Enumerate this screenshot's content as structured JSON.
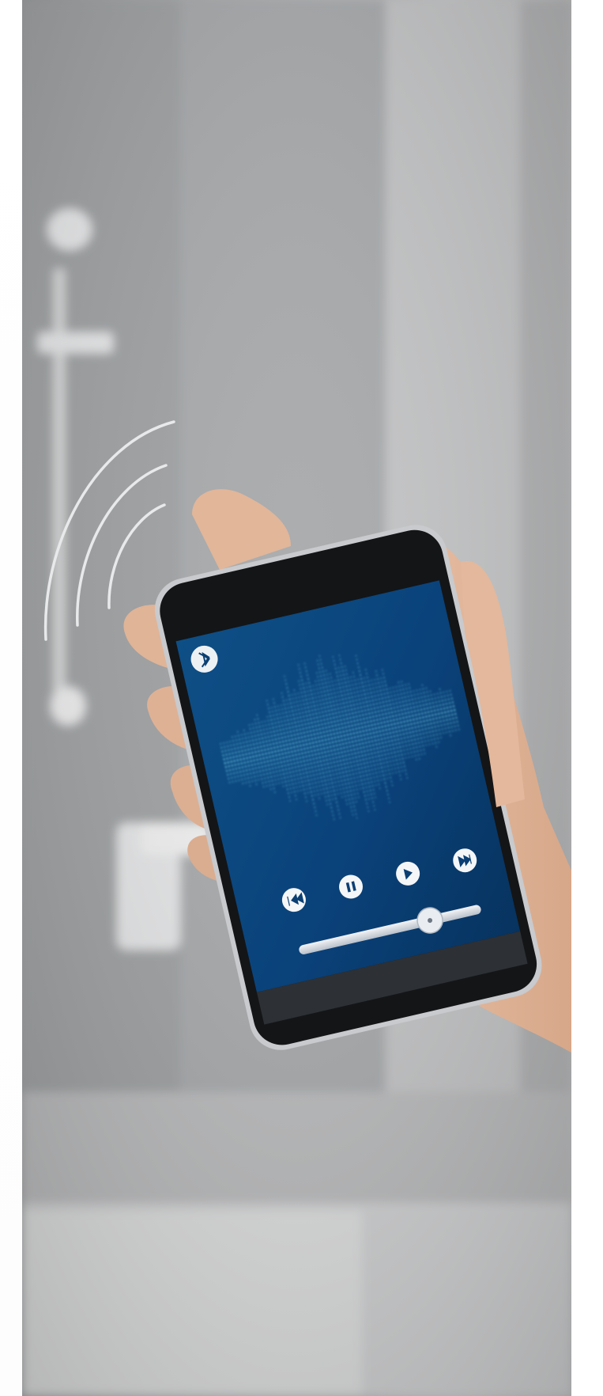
{
  "scene": {
    "subject": "hand-holding-smartphone-in-bathroom",
    "colors": {
      "screen_blue": "#0e4f86",
      "screen_blue_dark": "#07335f",
      "wave_cyan": "#7fe6ff",
      "bezel_black": "#141517",
      "wall_gray": "#a9abad"
    }
  },
  "phone": {
    "playback": {
      "progress": 0.72
    },
    "icons": [
      "bluetooth-icon",
      "previous-icon",
      "pause-icon",
      "play-icon",
      "next-icon"
    ]
  }
}
